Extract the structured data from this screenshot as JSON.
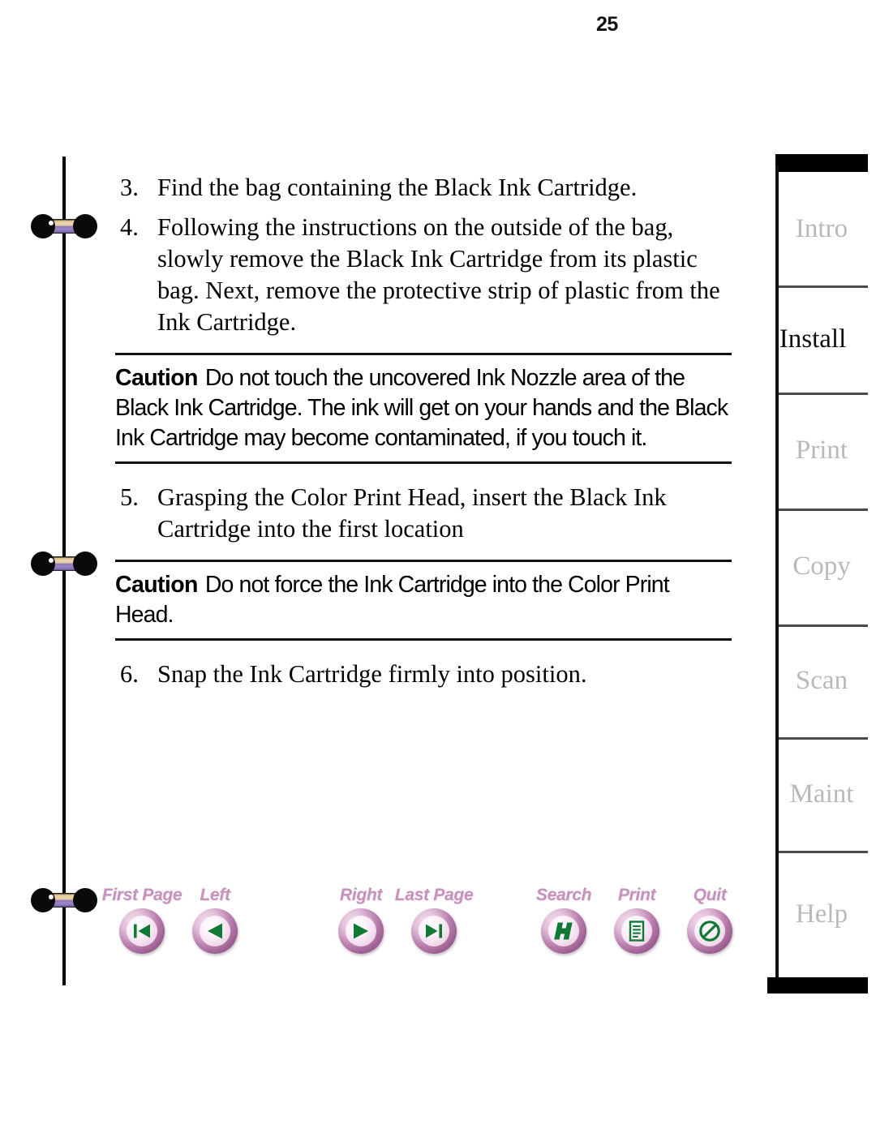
{
  "page": {
    "number": "25"
  },
  "content": {
    "steps": [
      {
        "number": "3.",
        "text": "Find the bag containing the Black Ink Cartridge."
      },
      {
        "number": "4.",
        "text": "Following the instructions on the outside of the bag, slowly remove the Black Ink Cartridge from its plastic bag. Next, remove the protective strip of plastic from the Ink Cartridge."
      },
      {
        "number": "5.",
        "text": "Grasping the Color Print Head, insert the Black Ink Cartridge into the first location"
      },
      {
        "number": "6.",
        "text": "Snap the Ink Cartridge firmly into position."
      }
    ],
    "cautions": [
      {
        "label": "Caution",
        "text": "Do not touch the uncovered Ink Nozzle area of the Black Ink Cartridge. The ink will get on your hands and the Black Ink Cartridge may become contaminated, if you touch it."
      },
      {
        "label": "Caution",
        "text": "Do not force the Ink Cartridge into the Color Print Head."
      }
    ]
  },
  "nav": {
    "left_group": [
      {
        "label": "First Page",
        "icon": "first-page-icon"
      },
      {
        "label": "Left",
        "icon": "previous-page-icon"
      },
      {
        "label": "Right",
        "icon": "next-page-icon"
      },
      {
        "label": "Last Page",
        "icon": "last-page-icon"
      }
    ],
    "right_group": [
      {
        "label": "Search",
        "icon": "search-icon"
      },
      {
        "label": "Print",
        "icon": "print-icon"
      },
      {
        "label": "Quit",
        "icon": "quit-icon"
      }
    ],
    "label_color": "#c792bd",
    "glyph_color": "#107a35"
  },
  "tabs": [
    {
      "label": "Intro",
      "active": false
    },
    {
      "label": "Install",
      "active": true
    },
    {
      "label": "Print",
      "active": false
    },
    {
      "label": "Copy",
      "active": false
    },
    {
      "label": "Scan",
      "active": false
    },
    {
      "label": "Maint",
      "active": false
    },
    {
      "label": "Help",
      "active": false
    }
  ],
  "colors": {
    "active_tab_text": "#0d0d0d",
    "inactive_tab_text": "#b9b9b9",
    "ring_gold": "#e2c494",
    "ring_purple": "#8b79bd",
    "rule": "#111111"
  }
}
